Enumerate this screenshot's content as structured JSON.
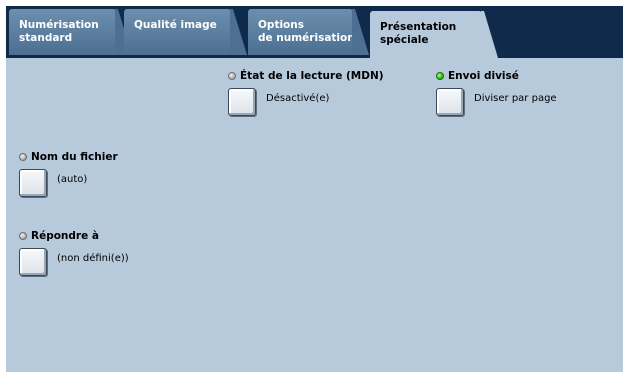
{
  "tabs": [
    {
      "line1": "Numérisation",
      "line2": "standard"
    },
    {
      "line1": "Qualité image",
      "line2": ""
    },
    {
      "line1": "Options",
      "line2": "de numérisation"
    },
    {
      "line1": "Présentation",
      "line2": "spéciale"
    }
  ],
  "active_tab_index": 3,
  "options": {
    "mdn": {
      "title": "État de la lecture (MDN)",
      "value": "Désactivé(e)",
      "indicator": "off"
    },
    "split_send": {
      "title": "Envoi divisé",
      "value": "Diviser par page",
      "indicator": "on"
    },
    "file_name": {
      "title": "Nom du fichier",
      "value": "(auto)",
      "indicator": "off"
    },
    "reply_to": {
      "title": "Répondre à",
      "value": "(non défini(e))",
      "indicator": "off"
    }
  },
  "colors": {
    "tabbar_background": "#0f2a4a",
    "inactive_tab": "#5a7d9f",
    "active_tab": "#b6cadc",
    "panel_background": "#b6cadc",
    "indicator_on": "#2fc014",
    "indicator_off": "#a8a8a8"
  }
}
